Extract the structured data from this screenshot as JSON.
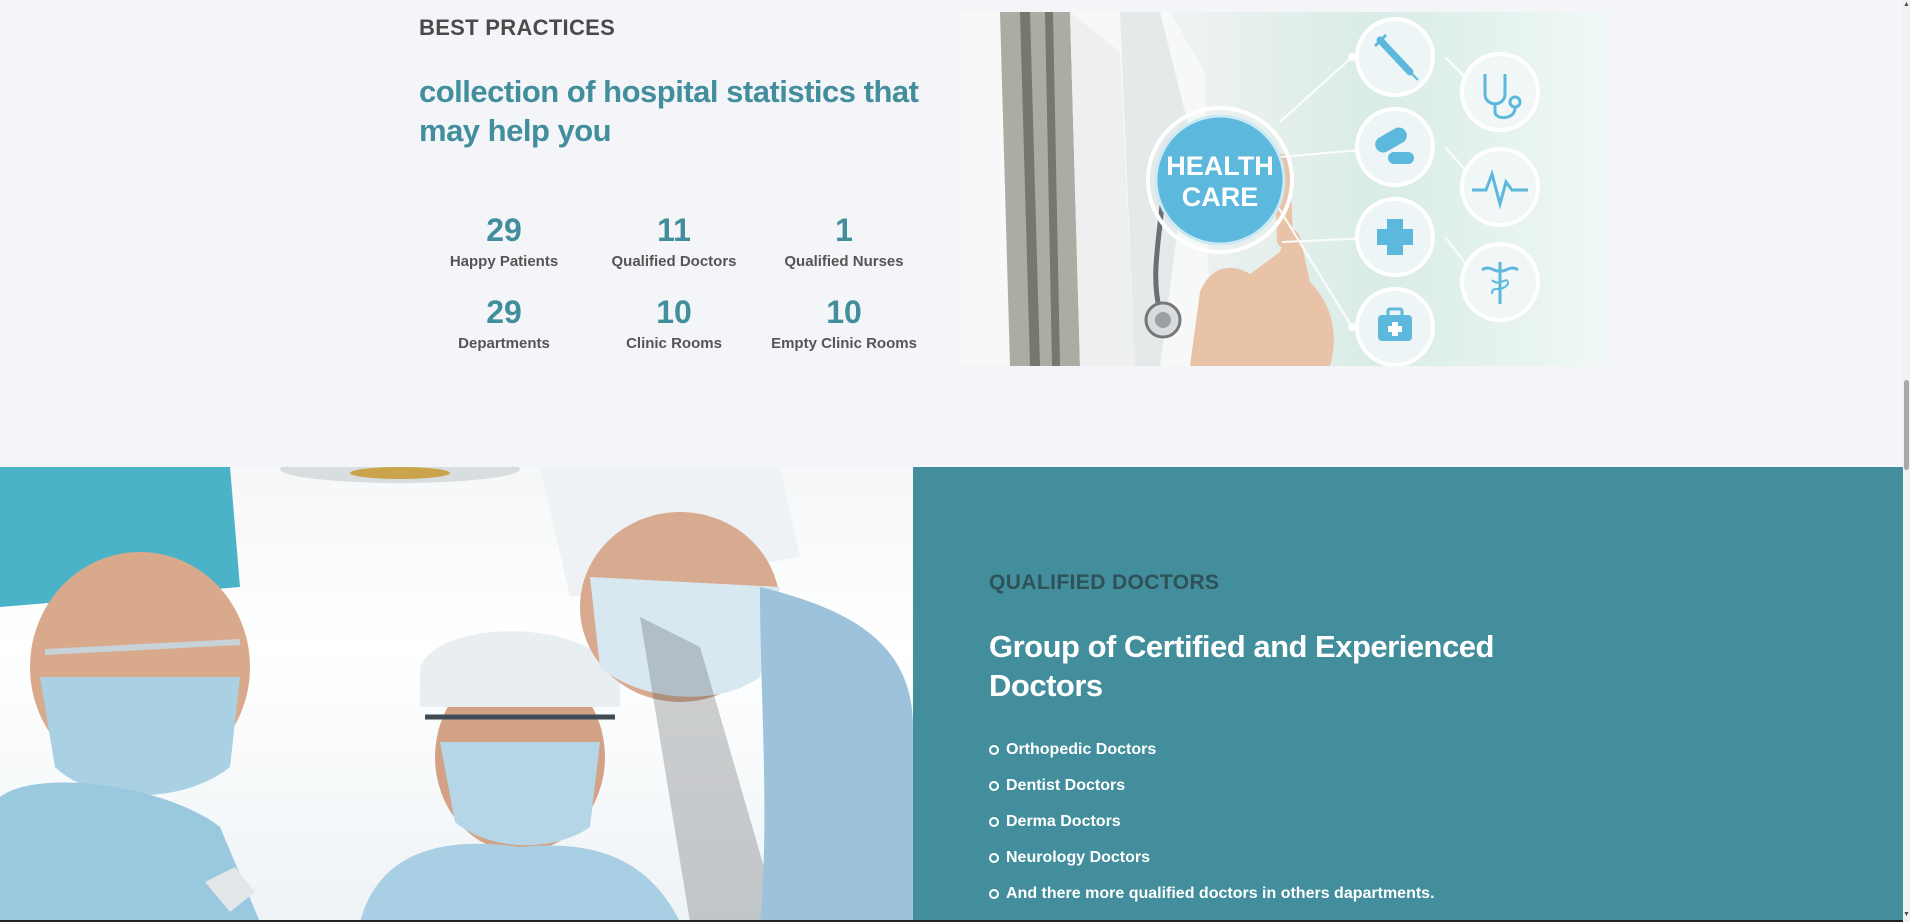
{
  "stats": {
    "eyebrow": "BEST PRACTICES",
    "headline": "collection of hospital statistics that may help you",
    "items": [
      {
        "value": "29",
        "label": "Happy Patients"
      },
      {
        "value": "11",
        "label": "Qualified Doctors"
      },
      {
        "value": "1",
        "label": "Qualified Nurses"
      },
      {
        "value": "29",
        "label": "Departments"
      },
      {
        "value": "10",
        "label": "Clinic Rooms"
      },
      {
        "value": "10",
        "label": "Empty Clinic Rooms"
      }
    ]
  },
  "health_image": {
    "badge_line1": "HEALTH",
    "badge_line2": "CARE",
    "icons": [
      "syringe-icon",
      "pills-icon",
      "medical-cross-icon",
      "first-aid-kit-icon",
      "stethoscope-icon",
      "heartbeat-icon",
      "caduceus-icon"
    ]
  },
  "doctors": {
    "eyebrow": "QUALIFIED DOCTORS",
    "headline": "Group of Certified and Experienced Doctors",
    "list": [
      "Orthopedic Doctors",
      "Dentist Doctors",
      "Derma Doctors",
      "Neurology Doctors",
      "And there more qualified doctors in others dapartments."
    ]
  },
  "colors": {
    "accent": "#428e9c",
    "page_background": "#f4f5f9",
    "dark_heading": "#4a4a4a",
    "panel_text": "#ffffff",
    "panel_eyebrow": "#2f5158",
    "icon_blue": "#5cb8dc"
  }
}
